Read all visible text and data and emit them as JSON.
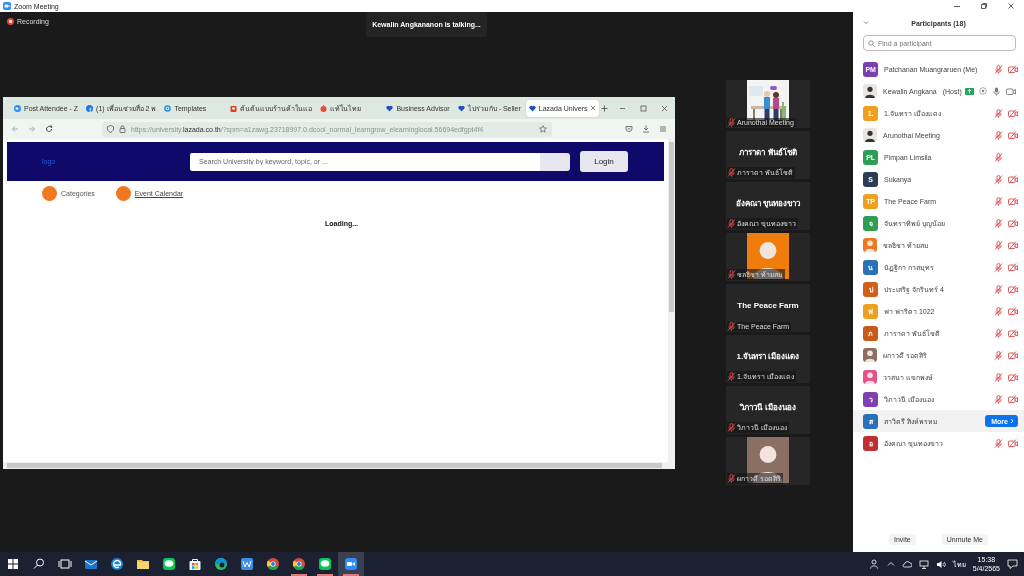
{
  "window": {
    "title": "Zoom Meeting"
  },
  "meeting": {
    "recording": "Recording",
    "talking": "Kewalin Angkananon is talking..."
  },
  "shared_browser": {
    "tabs": [
      {
        "label": "Post Attendee - Z",
        "kind": "zoom",
        "selected": false
      },
      {
        "label": "(1) เพื่อนช่วยสื่อ 2 พ",
        "kind": "facebook",
        "selected": false
      },
      {
        "label": "Templates",
        "kind": "globe",
        "selected": false
      },
      {
        "label": "ต้นต้นแบบร้านค้าในแอ",
        "kind": "shop",
        "selected": false
      },
      {
        "label": "แท้ในไทย",
        "kind": "apple",
        "selected": false
      },
      {
        "label": "Business Advisor",
        "kind": "heart",
        "selected": false
      },
      {
        "label": "ไปร่วมกับ - Seller",
        "kind": "heart",
        "selected": false
      },
      {
        "label": "Lazada Univers",
        "kind": "heart",
        "selected": true
      }
    ],
    "url": {
      "prefix": "https://university.",
      "domain": "lazada.co.th",
      "path": "/?spm=a1zawg.23718997.0.dcool_normal_learngrow_elearninglocal.56694edfgpt4f4"
    },
    "page": {
      "logo": "logo",
      "search": {
        "placeholder": "Search University by keyword, topic, or ..."
      },
      "login": "Login",
      "nav": [
        {
          "label": "Categories",
          "kind": "text"
        },
        {
          "label": "Event Calendar",
          "kind": "link"
        }
      ],
      "status": "Loading..."
    }
  },
  "video_tiles": [
    {
      "kind": "picture",
      "label": "Arunothai Meeting"
    },
    {
      "kind": "name",
      "display": "ภาราดา พันธ์โชติ",
      "label": "ภาราดา พันธ์โชติ"
    },
    {
      "kind": "name",
      "display": "อังคณา  ขุนทองขาว",
      "label": "อังคณา  ขุนทองขาว"
    },
    {
      "kind": "silhouette",
      "color": "#f07c0c",
      "label": "ชลธิชา ท้ายสม"
    },
    {
      "kind": "name",
      "display": "The Peace Farm",
      "label": "The Peace Farm"
    },
    {
      "kind": "name",
      "display": "1.จันทรา เมืองแดง",
      "label": "1.จันทรา เมืองแดง"
    },
    {
      "kind": "name",
      "display": "วิภาวนี  เมืองนอง",
      "label": "วิภาวนี  เมืองนอง"
    },
    {
      "kind": "silhouette",
      "color": "#8b6f62",
      "label": "ผกาวดี รอดสิริ"
    }
  ],
  "participants_panel": {
    "title": "Participants (18)",
    "search": {
      "placeholder": "Find a participant"
    },
    "participants": [
      {
        "name": "Patchanan Muangraruen (Me)",
        "kind": "initials",
        "initials": "PM",
        "color": "#7b3fb0",
        "mic_muted": true,
        "video_off": true,
        "hovered": false
      },
      {
        "name": "Kewalin Angkana",
        "role": "(Host)",
        "sharing": true,
        "mic_muted": false,
        "video_off": false,
        "hovered": false
      },
      {
        "name": "1.จันทรา เมืองแดง",
        "kind": "initials",
        "initials": "1.",
        "color": "#f0a020",
        "mic_muted": true,
        "video_off": true,
        "hovered": false
      },
      {
        "name": "Arunothai Meeting",
        "mic_muted": true,
        "video_off": true,
        "hovered": false
      },
      {
        "name": "Pimpan Limsila",
        "kind": "initials",
        "initials": "PL",
        "color": "#2e9e56",
        "mic_muted": true,
        "hovered": false
      },
      {
        "name": "Sukanya",
        "kind": "initials",
        "initials": "S",
        "color": "#2c3e55",
        "mic_muted": true,
        "video_off": true,
        "hovered": false
      },
      {
        "name": "The Peace Farm",
        "kind": "initials",
        "initials": "TP",
        "color": "#f0a020",
        "mic_muted": true,
        "video_off": true,
        "hovered": false
      },
      {
        "name": "จันทราทิพย์ บุญน้อย",
        "kind": "initials",
        "initials": "จ",
        "color": "#2e9e56",
        "mic_muted": true,
        "video_off": true,
        "hovered": false
      },
      {
        "name": "ชลธิชา ท้ายสม",
        "kind": "silhouette",
        "color": "#f07820",
        "mic_muted": true,
        "video_off": true,
        "hovered": false
      },
      {
        "name": "นัฏฐิกา กาสมุทร",
        "kind": "initials",
        "initials": "น",
        "color": "#2a72b8",
        "mic_muted": true,
        "video_off": true,
        "hovered": false
      },
      {
        "name": "ประเสริฐ จักรินทร์ 4",
        "kind": "initials",
        "initials": "ป",
        "color": "#d0601a",
        "mic_muted": true,
        "video_off": true,
        "hovered": false
      },
      {
        "name": "ฟา ฟาริดา 1022",
        "kind": "initials",
        "initials": "ฟ",
        "color": "#f0a020",
        "mic_muted": true,
        "video_off": true,
        "hovered": false
      },
      {
        "name": "ภาราดา พันธ์โชติ",
        "kind": "initials",
        "initials": "ภ",
        "color": "#c85a1a",
        "mic_muted": true,
        "video_off": true,
        "hovered": false
      },
      {
        "name": "ผกาวดี รอดสิริ",
        "kind": "silhouette",
        "color": "#8b6f62",
        "mic_muted": true,
        "video_off": true,
        "hovered": false
      },
      {
        "name": "วาสนา แขกพงษ์",
        "kind": "silhouette",
        "color": "#e8508a",
        "mic_muted": true,
        "video_off": true,
        "hovered": false
      },
      {
        "name": "วิภาวนี เมืองนอง",
        "kind": "initials",
        "initials": "ว",
        "color": "#8040b0",
        "mic_muted": true,
        "video_off": true,
        "hovered": false
      },
      {
        "name": "สาวิตรี สิงห์พรหม",
        "kind": "initials",
        "initials": "ส",
        "color": "#2a72b8",
        "hovered": true,
        "action": "More"
      },
      {
        "name": "อังคณา ขุนทองขาว",
        "kind": "initials",
        "initials": "อ",
        "color": "#c03030",
        "mic_muted": true,
        "video_off": true,
        "hovered": false
      }
    ],
    "buttons": [
      "Invite",
      "Unmute Me"
    ]
  },
  "taskbar": {
    "apps": [
      {
        "kind": "mail",
        "open": false,
        "active": false
      },
      {
        "kind": "edge",
        "open": false,
        "active": false
      },
      {
        "kind": "folder",
        "open": false,
        "active": false
      },
      {
        "kind": "chat",
        "open": false,
        "active": false
      },
      {
        "kind": "store",
        "open": false,
        "active": false
      },
      {
        "kind": "browser",
        "open": false,
        "active": false
      },
      {
        "kind": "writer",
        "open": false,
        "active": false
      },
      {
        "kind": "chrome",
        "open": false,
        "active": false
      },
      {
        "kind": "chrome",
        "open": true,
        "active": false
      },
      {
        "kind": "chat",
        "open": true,
        "active": false
      },
      {
        "kind": "video",
        "open": true,
        "active": true
      }
    ],
    "language": "ไทย",
    "time": "15:38",
    "date": "5/4/2565"
  }
}
